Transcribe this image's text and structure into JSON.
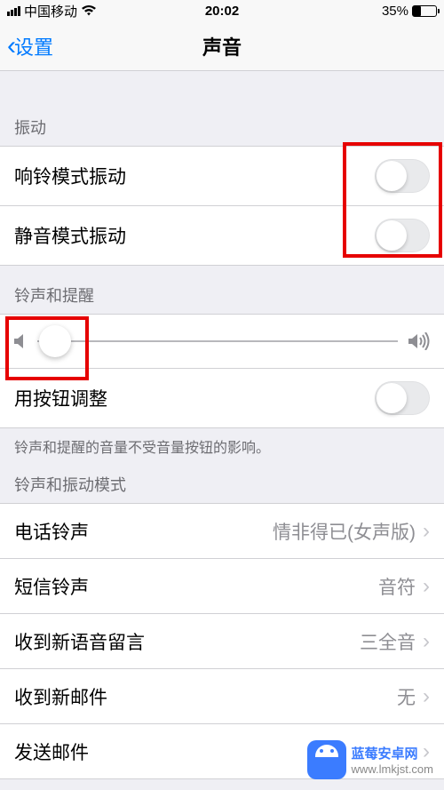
{
  "statusBar": {
    "carrier": "中国移动",
    "time": "20:02",
    "battery": "35%"
  },
  "nav": {
    "back": "设置",
    "title": "声音"
  },
  "sections": {
    "vibration": {
      "header": "振动",
      "ringVibrate": "响铃模式振动",
      "silentVibrate": "静音模式振动"
    },
    "ringtone": {
      "header": "铃声和提醒",
      "buttonAdjust": "用按钮调整",
      "footer": "铃声和提醒的音量不受音量按钮的影响。"
    },
    "patterns": {
      "header": "铃声和振动模式",
      "items": {
        "phone": {
          "label": "电话铃声",
          "value": "情非得已(女声版)"
        },
        "sms": {
          "label": "短信铃声",
          "value": "音符"
        },
        "voicemail": {
          "label": "收到新语音留言",
          "value": "三全音"
        },
        "newMail": {
          "label": "收到新邮件",
          "value": "无"
        },
        "sendMail": {
          "label": "发送邮件",
          "value": ""
        }
      }
    }
  },
  "watermark": {
    "title": "蓝莓安卓网",
    "url": "www.lmkjst.com"
  }
}
